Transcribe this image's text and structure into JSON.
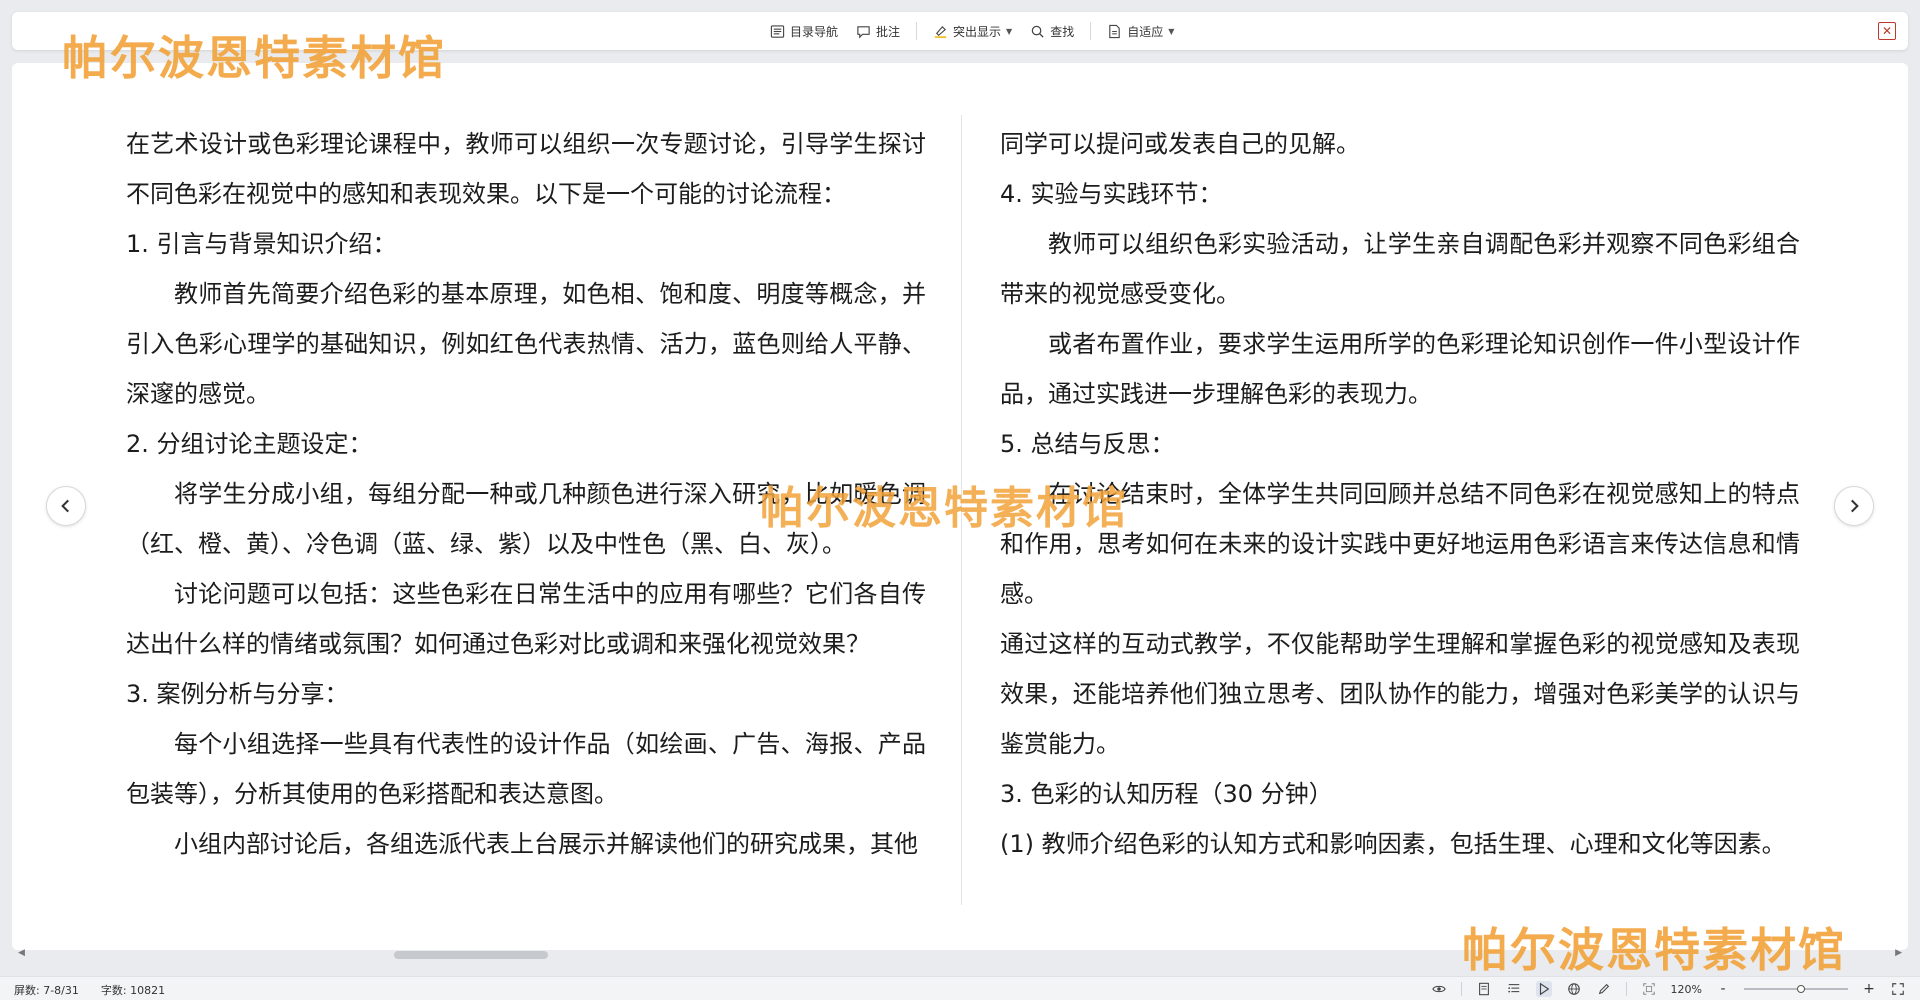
{
  "toolbar": {
    "items": [
      {
        "label": "目录导航",
        "icon": "list-icon"
      },
      {
        "label": "批注",
        "icon": "comment-icon"
      },
      {
        "label": "突出显示",
        "icon": "highlight-icon"
      },
      {
        "label": "查找",
        "icon": "search-icon"
      },
      {
        "label": "自适应",
        "icon": "page-fit-icon"
      }
    ],
    "close_icon": "close-icon"
  },
  "watermark": {
    "text": "帕尔波恩特素材馆",
    "color": "#f2a33a"
  },
  "document": {
    "left_column": [
      {
        "text": "在艺术设计或色彩理论课程中，教师可以组织一次专题讨论，引导学生探讨不同色彩在视觉中的感知和表现效果。以下是一个可能的讨论流程：",
        "indent": false
      },
      {
        "text": "1. 引言与背景知识介绍：",
        "indent": false
      },
      {
        "text": "教师首先简要介绍色彩的基本原理，如色相、饱和度、明度等概念，并引入色彩心理学的基础知识，例如红色代表热情、活力，蓝色则给人平静、深邃的感觉。",
        "indent": true
      },
      {
        "text": "2. 分组讨论主题设定：",
        "indent": false
      },
      {
        "text": "将学生分成小组，每组分配一种或几种颜色进行深入研究，比如暖色调（红、橙、黄）、冷色调（蓝、绿、紫）以及中性色（黑、白、灰）。",
        "indent": true
      },
      {
        "text": "讨论问题可以包括：这些色彩在日常生活中的应用有哪些？它们各自传达出什么样的情绪或氛围？如何通过色彩对比或调和来强化视觉效果？",
        "indent": true
      },
      {
        "text": "3. 案例分析与分享：",
        "indent": false
      },
      {
        "text": "每个小组选择一些具有代表性的设计作品（如绘画、广告、海报、产品包装等），分析其使用的色彩搭配和表达意图。",
        "indent": true
      },
      {
        "text": "小组内部讨论后，各组选派代表上台展示并解读他们的研究成果，其他",
        "indent": true
      }
    ],
    "right_column": [
      {
        "text": "同学可以提问或发表自己的见解。",
        "indent": false
      },
      {
        "text": "4. 实验与实践环节：",
        "indent": false
      },
      {
        "text": "教师可以组织色彩实验活动，让学生亲自调配色彩并观察不同色彩组合带来的视觉感受变化。",
        "indent": true
      },
      {
        "text": "或者布置作业，要求学生运用所学的色彩理论知识创作一件小型设计作品，通过实践进一步理解色彩的表现力。",
        "indent": true
      },
      {
        "text": "5. 总结与反思：",
        "indent": false
      },
      {
        "text": "在讨论结束时，全体学生共同回顾并总结不同色彩在视觉感知上的特点和作用，思考如何在未来的设计实践中更好地运用色彩语言来传达信息和情感。",
        "indent": true
      },
      {
        "text": "通过这样的互动式教学，不仅能帮助学生理解和掌握色彩的视觉感知及表现效果，还能培养他们独立思考、团队协作的能力，增强对色彩美学的认识与鉴赏能力。",
        "indent": false
      },
      {
        "text": "3. 色彩的认知历程（30 分钟）",
        "indent": false
      },
      {
        "text": "(1) 教师介绍色彩的认知方式和影响因素，包括生理、心理和文化等因素。",
        "indent": false
      }
    ]
  },
  "navigation": {
    "prev_icon": "chevron-left-icon",
    "next_icon": "chevron-right-icon"
  },
  "statusbar": {
    "page_info": "屏数: 7-8/31",
    "word_count": "字数: 10821",
    "zoom_level": "120%",
    "zoom_fraction": 0.55,
    "zoom_minus": "-",
    "zoom_plus": "+"
  }
}
